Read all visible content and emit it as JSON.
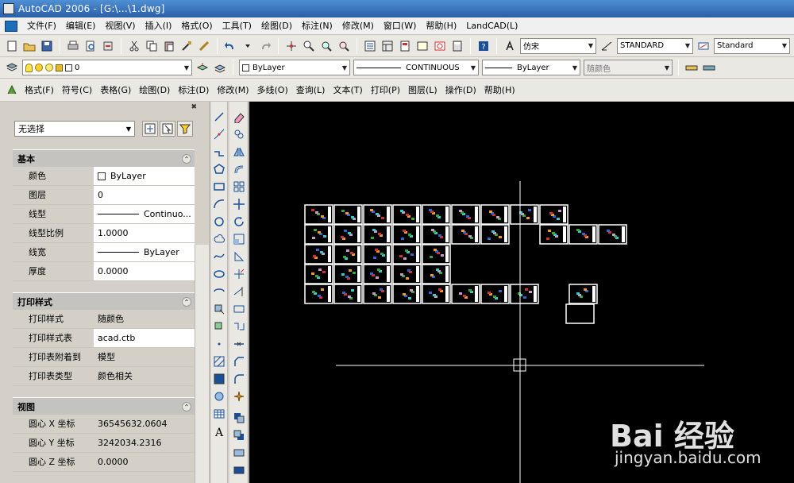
{
  "window": {
    "title": "AutoCAD 2006 - [G:\\...\\1.dwg]"
  },
  "menubar": {
    "items": [
      "文件(F)",
      "编辑(E)",
      "视图(V)",
      "插入(I)",
      "格式(O)",
      "工具(T)",
      "绘图(D)",
      "标注(N)",
      "修改(M)",
      "窗口(W)",
      "帮助(H)",
      "LandCAD(L)"
    ]
  },
  "toolbar1": {
    "font_combo": "仿宋",
    "textstyle_combo": "STANDARD",
    "dimstyle_combo": "Standard"
  },
  "toolbar2": {
    "layer_combo": "0",
    "color_combo": "ByLayer",
    "linetype_combo": "CONTINUOUS",
    "lineweight_combo": "ByLayer",
    "plotstyle_combo": "随颜色"
  },
  "toolbar3": {
    "items": [
      "格式(F)",
      "符号(C)",
      "表格(G)",
      "绘图(D)",
      "标注(D)",
      "修改(M)",
      "多线(O)",
      "查询(L)",
      "文本(T)",
      "打印(P)",
      "图层(L)",
      "操作(D)",
      "帮助(H)"
    ]
  },
  "properties": {
    "selection": "无选择",
    "sections": [
      {
        "title": "基本",
        "rows": [
          {
            "label": "颜色",
            "value": "ByLayer"
          },
          {
            "label": "图层",
            "value": "0"
          },
          {
            "label": "线型",
            "value": "Continuo..."
          },
          {
            "label": "线型比例",
            "value": "1.0000"
          },
          {
            "label": "线宽",
            "value": "ByLayer"
          },
          {
            "label": "厚度",
            "value": "0.0000"
          }
        ]
      },
      {
        "title": "打印样式",
        "rows": [
          {
            "label": "打印样式",
            "value": "随颜色"
          },
          {
            "label": "打印样式表",
            "value": "acad.ctb"
          },
          {
            "label": "打印表附着到",
            "value": "模型"
          },
          {
            "label": "打印表类型",
            "value": "颜色相关"
          }
        ]
      },
      {
        "title": "视图",
        "rows": [
          {
            "label": "圆心 X 坐标",
            "value": "36545632.0604"
          },
          {
            "label": "圆心 Y 坐标",
            "value": "3242034.2316"
          },
          {
            "label": "圆心 Z 坐标",
            "value": "0.0000"
          }
        ]
      }
    ]
  },
  "watermark": {
    "logo": "Bai 经验",
    "url": "jingyan.baidu.com"
  },
  "colors": {
    "canvas": "#000000",
    "titlebar": "#2a5fa8"
  }
}
